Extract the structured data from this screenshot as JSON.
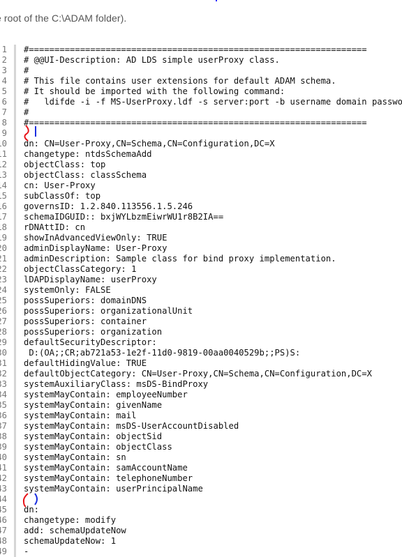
{
  "intro_text": "e root of the C:\\ADAM folder).",
  "code": {
    "lines": [
      {
        "n": "1",
        "text": "#=================================================================="
      },
      {
        "n": "2",
        "text": "# @@UI-Description: AD LDS simple userProxy class."
      },
      {
        "n": "3",
        "text": "#"
      },
      {
        "n": "4",
        "text": "# This file contains user extensions for default ADAM schema."
      },
      {
        "n": "5",
        "text": "# It should be imported with the following command:"
      },
      {
        "n": "6",
        "text": "#   ldifde -i -f MS-UserProxy.ldf -s server:port -b username domain password -j . -c \"CN=Schema,CN=Configuration,DC=X\" #schemaNamingContext"
      },
      {
        "n": "7",
        "text": "#"
      },
      {
        "n": "8",
        "text": "#=================================================================="
      },
      {
        "n": "9",
        "text": ""
      },
      {
        "n": "10",
        "text": "dn: CN=User-Proxy,CN=Schema,CN=Configuration,DC=X"
      },
      {
        "n": "11",
        "text": "changetype: ntdsSchemaAdd"
      },
      {
        "n": "12",
        "text": "objectClass: top"
      },
      {
        "n": "13",
        "text": "objectClass: classSchema"
      },
      {
        "n": "14",
        "text": "cn: User-Proxy"
      },
      {
        "n": "15",
        "text": "subClassOf: top"
      },
      {
        "n": "16",
        "text": "governsID: 1.2.840.113556.1.5.246"
      },
      {
        "n": "17",
        "text": "schemaIDGUID:: bxjWYLbzmEiwrWU1r8B2IA=="
      },
      {
        "n": "18",
        "text": "rDNAttID: cn"
      },
      {
        "n": "19",
        "text": "showInAdvancedViewOnly: TRUE"
      },
      {
        "n": "20",
        "text": "adminDisplayName: User-Proxy"
      },
      {
        "n": "21",
        "text": "adminDescription: Sample class for bind proxy implementation."
      },
      {
        "n": "22",
        "text": "objectClassCategory: 1"
      },
      {
        "n": "23",
        "text": "lDAPDisplayName: userProxy"
      },
      {
        "n": "24",
        "text": "systemOnly: FALSE"
      },
      {
        "n": "25",
        "text": "possSuperiors: domainDNS"
      },
      {
        "n": "26",
        "text": "possSuperiors: organizationalUnit"
      },
      {
        "n": "27",
        "text": "possSuperiors: container"
      },
      {
        "n": "28",
        "text": "possSuperiors: organization"
      },
      {
        "n": "29",
        "text": "defaultSecurityDescriptor:"
      },
      {
        "n": "30",
        "text": " D:(OA;;CR;ab721a53-1e2f-11d0-9819-00aa0040529b;;PS)S:"
      },
      {
        "n": "31",
        "text": "defaultHidingValue: TRUE"
      },
      {
        "n": "32",
        "text": "defaultObjectCategory: CN=User-Proxy,CN=Schema,CN=Configuration,DC=X"
      },
      {
        "n": "33",
        "text": "systemAuxiliaryClass: msDS-BindProxy"
      },
      {
        "n": "34",
        "text": "systemMayContain: employeeNumber"
      },
      {
        "n": "35",
        "text": "systemMayContain: givenName"
      },
      {
        "n": "36",
        "text": "systemMayContain: mail"
      },
      {
        "n": "37",
        "text": "systemMayContain: msDS-UserAccountDisabled"
      },
      {
        "n": "38",
        "text": "systemMayContain: objectSid"
      },
      {
        "n": "39",
        "text": "systemMayContain: objectClass"
      },
      {
        "n": "40",
        "text": "systemMayContain: sn"
      },
      {
        "n": "41",
        "text": "systemMayContain: samAccountName"
      },
      {
        "n": "42",
        "text": "systemMayContain: telephoneNumber"
      },
      {
        "n": "43",
        "text": "systemMayContain: userPrincipalName"
      },
      {
        "n": "44",
        "text": ""
      },
      {
        "n": "45",
        "text": "dn:"
      },
      {
        "n": "46",
        "text": "changetype: modify"
      },
      {
        "n": "47",
        "text": "add: schemaUpdateNow"
      },
      {
        "n": "48",
        "text": "schemaUpdateNow: 1"
      },
      {
        "n": "49",
        "text": "-"
      }
    ]
  },
  "annotations": {
    "red_color": "#e8141a",
    "blue_color": "#1a2ee0"
  }
}
